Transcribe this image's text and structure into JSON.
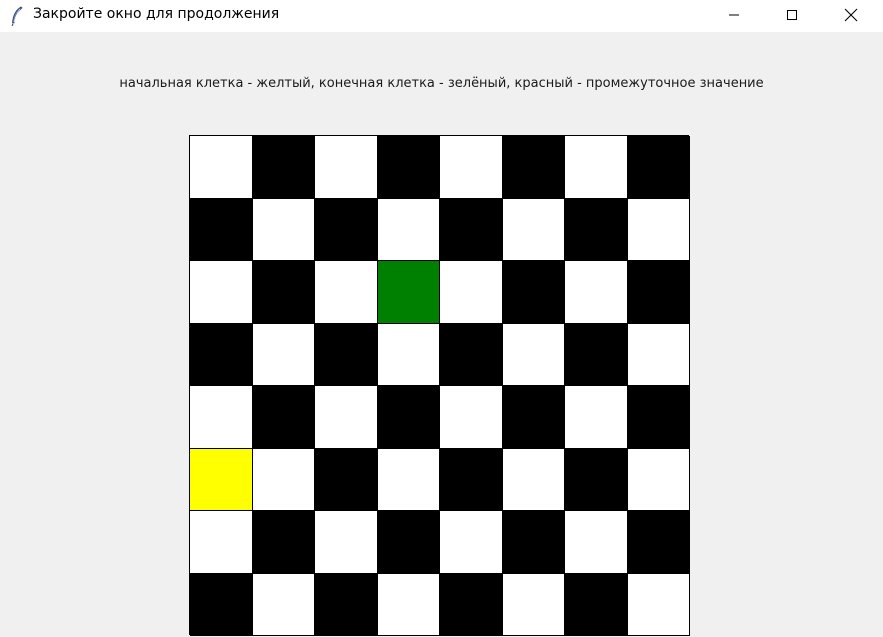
{
  "window": {
    "title": "Закройте окно для продолжения",
    "icon": "feather-icon",
    "controls": [
      "minimize-icon",
      "maximize-icon",
      "close-icon"
    ]
  },
  "legend": {
    "text": "начальная клетка - желтый, конечная клетка - зелёный, красный - промежуточное значение"
  },
  "board": {
    "rows": 8,
    "cols": 8,
    "colors": {
      "light": "#ffffff",
      "dark": "#000000",
      "start": "#ffff00",
      "end": "#008000",
      "intermediate": "#ff0000"
    },
    "start_cell": {
      "row": 5,
      "col": 0
    },
    "end_cell": {
      "row": 2,
      "col": 3
    },
    "intermediate_cells": []
  }
}
